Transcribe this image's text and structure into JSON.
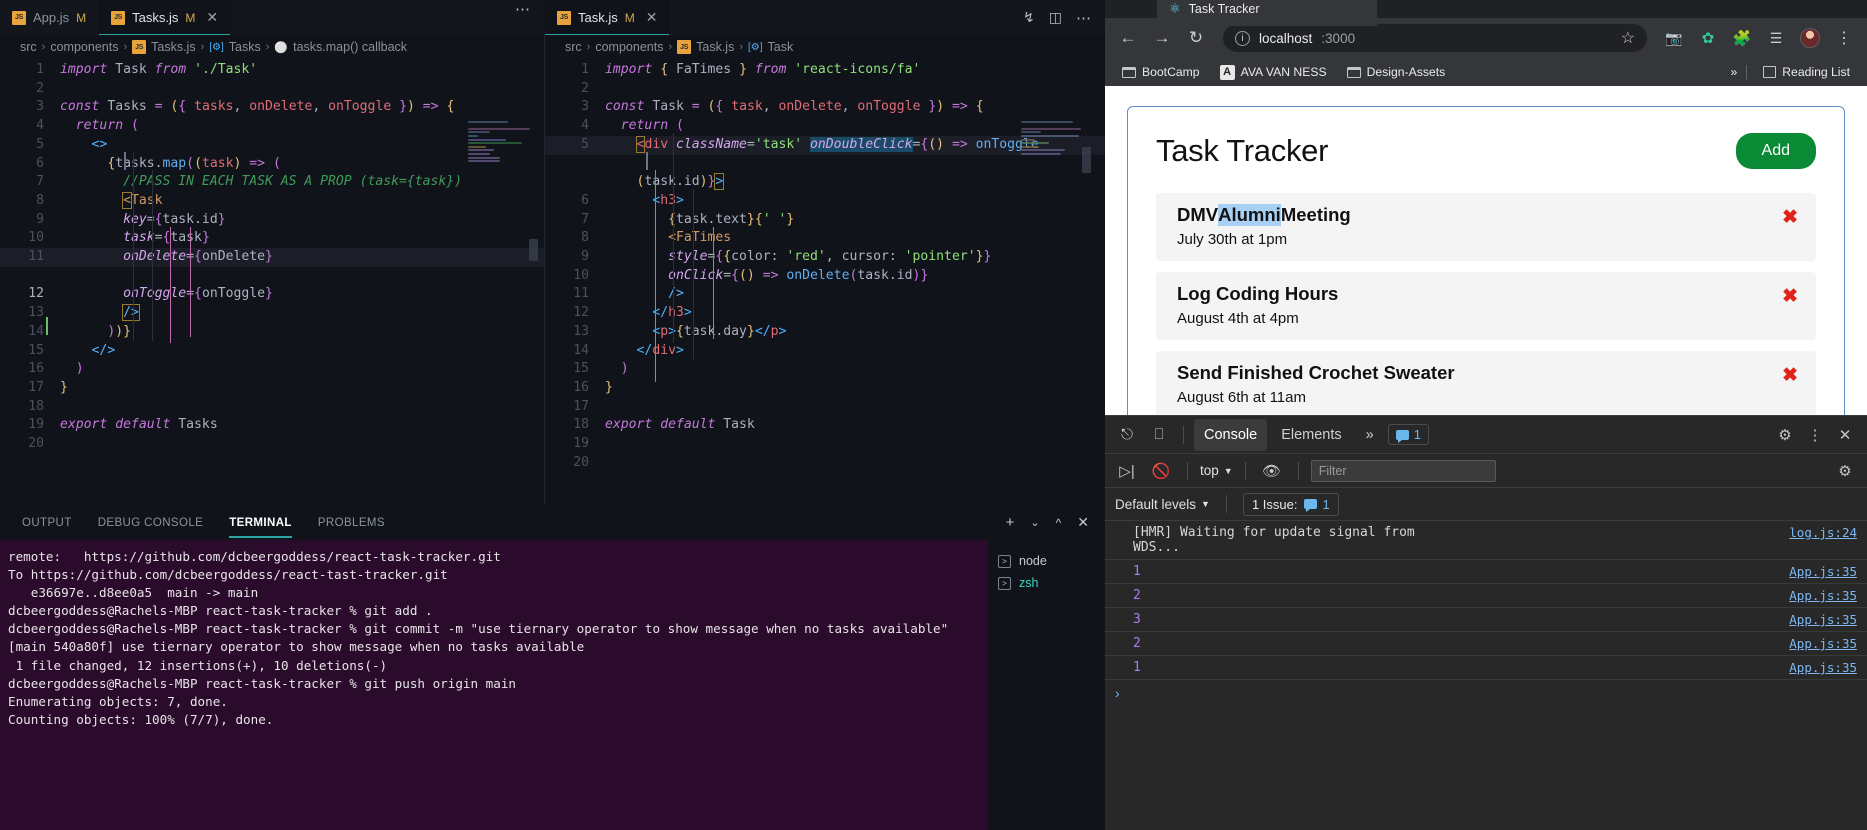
{
  "vscode": {
    "tabs_left": [
      {
        "label": "App.js",
        "modified": "M",
        "icon": "js-file-icon",
        "active": false,
        "closable": false
      },
      {
        "label": "Tasks.js",
        "modified": "M",
        "icon": "js-file-icon",
        "active": true,
        "closable": true
      }
    ],
    "tabs_right": [
      {
        "label": "Task.js",
        "modified": "M",
        "icon": "js-file-icon",
        "active": true,
        "closable": true
      }
    ],
    "tab_actions": [
      "source-control-icon",
      "split-editor-icon",
      "more-actions-icon"
    ],
    "left_breadcrumb": [
      "src",
      "components",
      "Tasks.js",
      "Tasks",
      "tasks.map() callback"
    ],
    "right_breadcrumb": [
      "src",
      "components",
      "Task.js",
      "Task"
    ],
    "left_code_lines": [
      "import Task from './Task'",
      "",
      "const Tasks = ({ tasks, onDelete, onToggle }) => {",
      "  return (",
      "    <>",
      "      {tasks.map((task) => (",
      "        //PASS IN EACH TASK AS A PROP (task={task})",
      "        <Task",
      "         key={task.id}",
      "         task={task}",
      "         onDelete={onDelete}",
      "         onToggle={onToggle}",
      "         />",
      "      ))}",
      "    </>",
      "  )",
      "}",
      "",
      "export default Tasks",
      ""
    ],
    "right_code_lines": [
      "import { FaTimes } from 'react-icons/fa'",
      "",
      "const Task = ({ task, onDelete, onToggle }) => {",
      "  return (",
      "    <div className='task' onDoubleClick={() => onToggle(task.id)}>",
      "      <h3>",
      "        {task.text}{' '}",
      "        <FaTimes",
      "        style={{color: 'red', cursor: 'pointer'}}",
      "        onClick={() => onDelete(task.id)}",
      "        />",
      "      </h3>",
      "      <p>{task.day}</p>",
      "    </div>",
      "  )",
      "}",
      "",
      "export default Task",
      ""
    ],
    "panel": {
      "tabs": [
        {
          "label": "OUTPUT",
          "active": false
        },
        {
          "label": "DEBUG CONSOLE",
          "active": false
        },
        {
          "label": "TERMINAL",
          "active": true
        },
        {
          "label": "PROBLEMS",
          "active": false
        }
      ],
      "actions": [
        "new-terminal-icon",
        "terminal-dropdown-icon",
        "maximize-panel-icon",
        "close-panel-icon"
      ],
      "terminal_lines": [
        "remote:   https://github.com/dcbeergoddess/react-task-tracker.git",
        "To https://github.com/dcbeergoddess/react-tast-tracker.git",
        "   e36697e..d8ee0a5  main -> main",
        "dcbeergoddess@Rachels-MBP react-task-tracker % git add .",
        "dcbeergoddess@Rachels-MBP react-task-tracker % git commit -m \"use tiernary operator to show message when no tasks available\"",
        "[main 540a80f] use tiernary operator to show message when no tasks available",
        " 1 file changed, 12 insertions(+), 10 deletions(-)",
        "dcbeergoddess@Rachels-MBP react-task-tracker % git push origin main",
        "Enumerating objects: 7, done.",
        "Counting objects: 100% (7/7), done."
      ],
      "terminal_sessions": [
        {
          "label": "node",
          "active": false
        },
        {
          "label": "zsh",
          "active": true
        }
      ]
    }
  },
  "browser": {
    "tab_title": "Task Tracker",
    "tab_favicon": "react-logo-icon",
    "nav_icons": [
      "back-icon",
      "forward-icon",
      "reload-icon"
    ],
    "address": {
      "host": "localhost",
      "port": ":3000",
      "security_icon": "info-circle-icon",
      "star_icon": "bookmark-star-icon"
    },
    "toolbar_icons": [
      "camera-extension-icon",
      "leaf-extension-icon",
      "puzzle-extensions-icon",
      "playlist-icon",
      "profile-avatar-icon",
      "chrome-menu-icon"
    ],
    "bookmarks": [
      {
        "label": "BootCamp",
        "icon": "folder-icon"
      },
      {
        "label": "AVA VAN NESS",
        "icon": "letter-a-icon"
      },
      {
        "label": "Design-Assets",
        "icon": "folder-icon"
      }
    ],
    "bookmarks_overflow": "»",
    "reading_list": {
      "label": "Reading List",
      "icon": "reading-list-icon"
    }
  },
  "app": {
    "title": "Task Tracker",
    "add_button": "Add",
    "tasks": [
      {
        "text_before": "DMV ",
        "text_selected": "Alumni",
        "text_after": " Meeting",
        "day": "July 30th at 1pm",
        "delete_icon": "x-delete-icon"
      },
      {
        "text_before": "Log Coding Hours",
        "text_selected": "",
        "text_after": "",
        "day": "August 4th at 4pm",
        "delete_icon": "x-delete-icon"
      },
      {
        "text_before": "Send Finished Crochet Sweater",
        "text_selected": "",
        "text_after": "",
        "day": "August 6th at 11am",
        "delete_icon": "x-delete-icon"
      }
    ]
  },
  "devtools": {
    "left_icons": [
      "inspect-element-icon",
      "device-toolbar-icon"
    ],
    "tabs": [
      {
        "label": "Console",
        "active": true
      },
      {
        "label": "Elements",
        "active": false
      }
    ],
    "more_tabs": "»",
    "issues_badge": "1",
    "right_icons": [
      "settings-gear-icon",
      "more-options-icon",
      "close-devtools-icon"
    ],
    "toolbar": {
      "execute_icon": "run-script-icon",
      "clear_icon": "clear-console-icon",
      "context": "top",
      "eye_icon": "live-expression-icon",
      "filter_placeholder": "Filter",
      "settings_icon": "console-settings-icon"
    },
    "levels": "Default levels",
    "issues_label": "1 Issue:",
    "issues_count": "1",
    "messages": [
      {
        "text": "[HMR] Waiting for update signal from WDS...",
        "count": "",
        "source": "log.js:24"
      },
      {
        "text": "",
        "count": "1",
        "source": "App.js:35"
      },
      {
        "text": "",
        "count": "2",
        "source": "App.js:35"
      },
      {
        "text": "",
        "count": "3",
        "source": "App.js:35"
      },
      {
        "text": "",
        "count": "2",
        "source": "App.js:35"
      },
      {
        "text": "",
        "count": "1",
        "source": "App.js:35"
      }
    ],
    "prompt": "›"
  },
  "colors": {
    "accent_teal": "#2aa5a0",
    "terminal_bg": "#2a0b2b",
    "add_green": "#0b8a36",
    "delete_red": "#e2231a",
    "selection_blue": "#a8d0f5",
    "card_border": "#5b8fc9"
  }
}
